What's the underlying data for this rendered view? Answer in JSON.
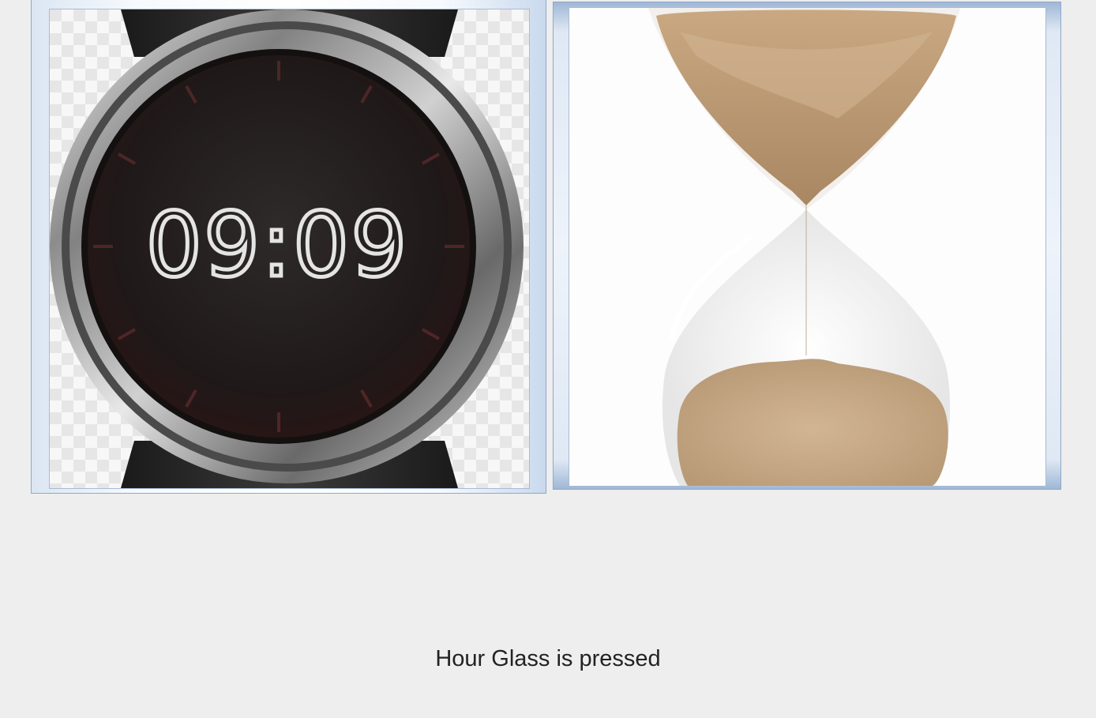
{
  "buttons": {
    "watch": {
      "icon": "watch-icon",
      "display_time": "09:09"
    },
    "hourglass": {
      "icon": "hourglass-icon"
    }
  },
  "status": {
    "text": "Hour Glass is pressed"
  },
  "colors": {
    "background": "#eeeeee",
    "button_border": "#8fa8c8",
    "watch_face": "#221c1c",
    "watch_bezel": "#bcbcbc",
    "sand": "#c9a882"
  }
}
